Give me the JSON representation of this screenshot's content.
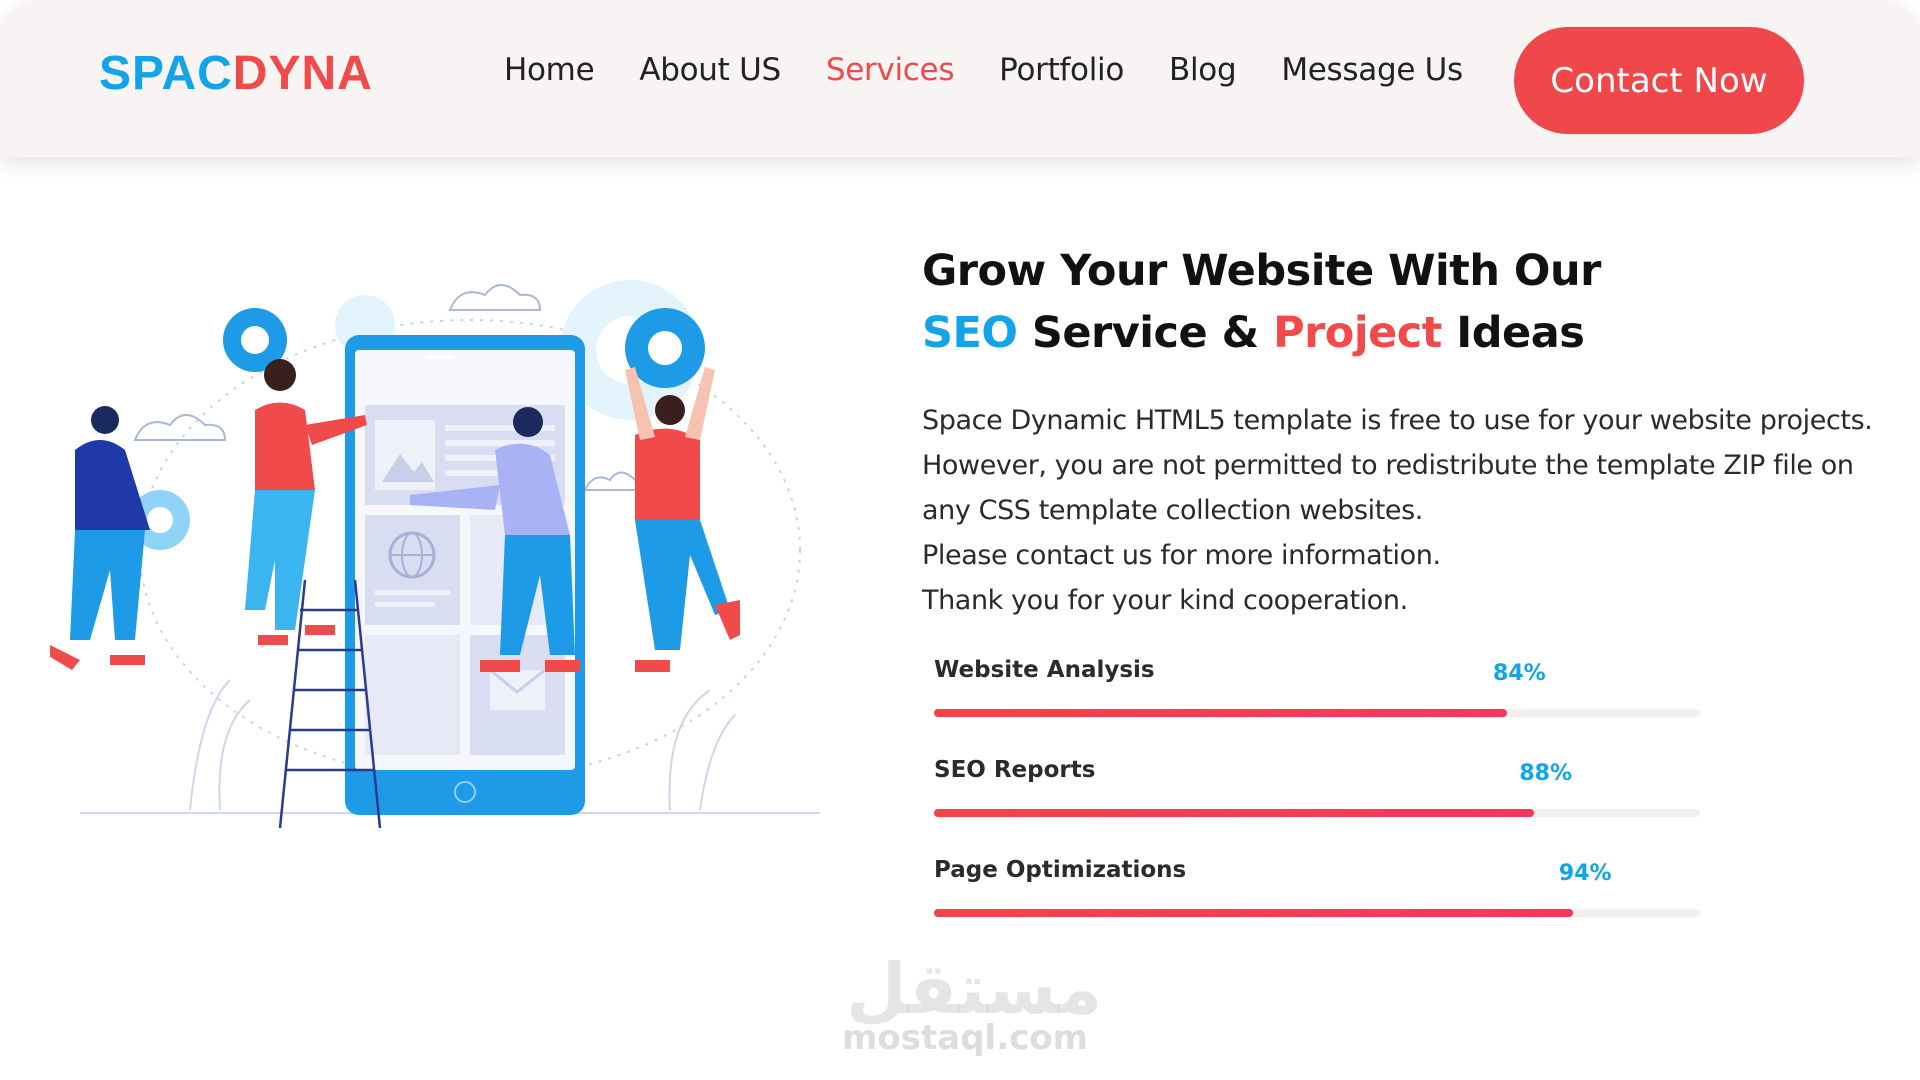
{
  "header": {
    "logo_part1": "SPAC",
    "logo_part2": "DYNA",
    "nav": [
      "Home",
      "About US",
      "Services",
      "Portfolio",
      "Blog",
      "Message Us"
    ],
    "active_nav": "Services",
    "contact_button": "Contact Now"
  },
  "hero": {
    "headline_line1": "Grow Your Website With Our",
    "headline_seo": "SEO",
    "headline_mid": " Service & ",
    "headline_project": "Project",
    "headline_end": " Ideas",
    "description": [
      "Space Dynamic HTML5 template is free to use for your website projects.",
      "However, you are not permitted to redistribute the template ZIP file on",
      "any CSS template collection websites.",
      "Please contact us for more information.",
      "Thank you for your kind cooperation."
    ]
  },
  "skills": [
    {
      "label": "Website Analysis",
      "percent_text": "84%",
      "value": 0.84
    },
    {
      "label": "SEO Reports",
      "percent_text": "88%",
      "value": 0.88
    },
    {
      "label": "Page Optimizations",
      "percent_text": "94%",
      "value": 0.94
    }
  ],
  "watermark": {
    "arabic": "مستقل",
    "latin": "mostaql.com"
  },
  "colors": {
    "blue": "#12a3e8",
    "red": "#f04a4a",
    "header_bg": "#f7f4f3"
  },
  "illustration_icons": [
    "phone-icon",
    "gear-icon",
    "cloud-icon",
    "image-icon",
    "globe-icon",
    "mail-icon",
    "ladder-icon"
  ]
}
